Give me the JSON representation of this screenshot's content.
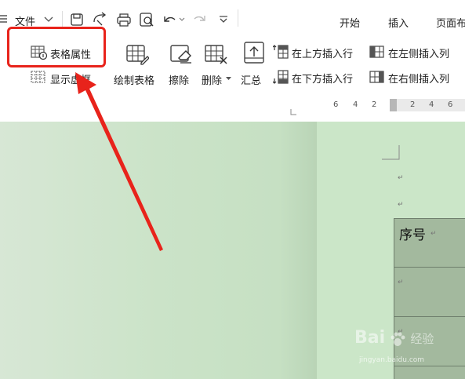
{
  "menu": {
    "file_label": "文件",
    "tabs": [
      "开始",
      "插入",
      "页面布"
    ]
  },
  "ribbon": {
    "table_properties": "表格属性",
    "show_gridlines": "显示虚框",
    "draw_table": "绘制表格",
    "eraser": "擦除",
    "delete": "删除",
    "summary": "汇总",
    "insert_row_above": "在上方插入行",
    "insert_row_below": "在下方插入行",
    "insert_col_left": "在左侧插入列",
    "insert_col_right": "在右侧插入列"
  },
  "ruler": {
    "left_numbers": [
      "6",
      "4",
      "2"
    ],
    "right_numbers": [
      "2",
      "4",
      "6"
    ]
  },
  "document": {
    "table_header": "序号",
    "paragraph_mark": "↵"
  },
  "watermark": {
    "brand": "Bai",
    "brand_suffix": "经验",
    "url": "jingyan.baidu.com"
  },
  "colors": {
    "highlight": "#e8231b",
    "doc_background": "#cbe6c8",
    "table_fill": "#a3b99e"
  },
  "icons": [
    "menu-icon",
    "chevron-down-icon",
    "save-icon",
    "redo-icon",
    "print-icon",
    "preview-icon",
    "undo-icon",
    "more-icon",
    "table-properties-icon",
    "gridlines-icon",
    "draw-table-icon",
    "eraser-icon",
    "delete-table-icon",
    "summary-icon",
    "insert-row-above-icon",
    "insert-row-below-icon",
    "insert-col-left-icon",
    "insert-col-right-icon",
    "annotation-arrow"
  ]
}
